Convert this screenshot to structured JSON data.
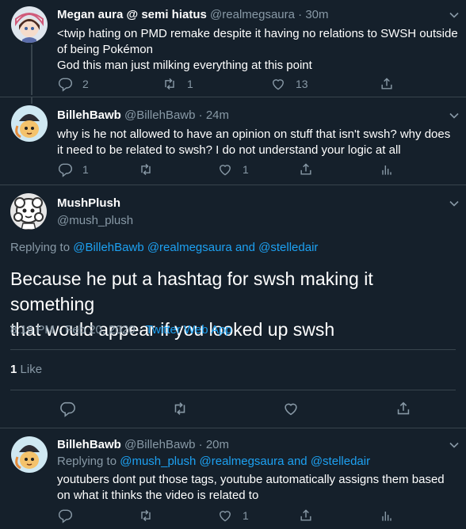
{
  "tweets": [
    {
      "name": "Megan aura @ semi hiatus",
      "handle": "@realmegsaura",
      "sep": "·",
      "time": "30m",
      "lines": [
        "<twip hating on PMD remake despite it having no relations to SWSH outside",
        "of being Pokémon",
        "God this man just milking everything at this point"
      ],
      "replies": "2",
      "retweets": "1",
      "likes": "13"
    },
    {
      "name": "BillehBawb",
      "handle": "@BillehBawb",
      "sep": "·",
      "time": "24m",
      "lines": [
        "why is he not allowed to have an opinion on stuff that isn't swsh? why does",
        "it need to be related to swsh? I do not understand your logic at all"
      ],
      "replies": "1",
      "retweets": "",
      "likes": "1"
    }
  ],
  "main": {
    "name": "MushPlush",
    "handle": "@mush_plush",
    "replying_prefix": "Replying to",
    "replying_to": [
      "@BillehBawb",
      "@realmegsaura",
      "and",
      "@stelledair"
    ],
    "lines": [
      "Because he put a hashtag for swsh making it something",
      "that would appear if you looked up swsh"
    ],
    "time": "8:16 PM · Feb 20, 2020",
    "sep": "·",
    "source": "Twitter Web App",
    "like_count": "1",
    "like_label": "Like"
  },
  "reply": {
    "name": "BillehBawb",
    "handle": "@BillehBawb",
    "sep": "·",
    "time": "20m",
    "replying_prefix": "Replying to",
    "replying_to": [
      "@mush_plush",
      "@realmegsaura",
      "and",
      "@stelledair"
    ],
    "lines": [
      "youtubers dont put those tags, youtube automatically assigns them based",
      "on what it thinks the video is related to"
    ],
    "replies": "",
    "likes": "1"
  },
  "colors": {
    "background": "#15202b",
    "text": "#ffffff",
    "muted": "#8899a6",
    "link": "#1da1f2",
    "border": "#38444d"
  },
  "icons": [
    "reply-icon",
    "retweet-icon",
    "like-icon",
    "share-icon",
    "analytics-icon",
    "chevron-down-icon"
  ]
}
